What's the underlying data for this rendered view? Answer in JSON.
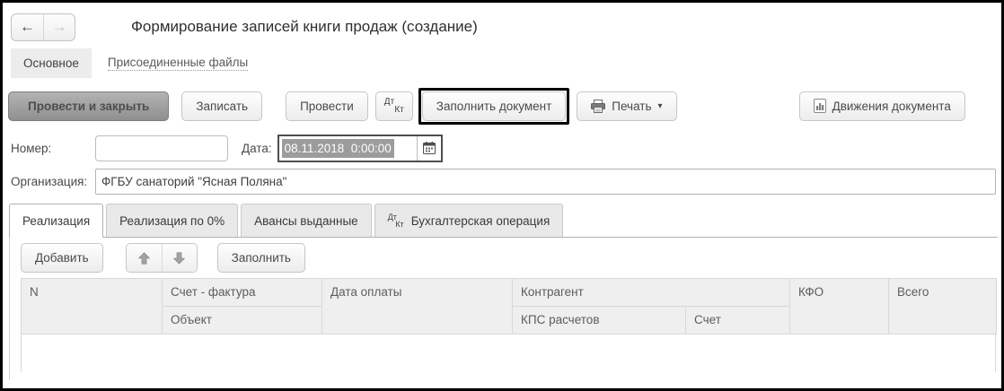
{
  "window": {
    "title": "Формирование записей книги продаж (создание)",
    "nav": {
      "back_glyph": "←",
      "forward_glyph": "→"
    }
  },
  "section_tabs": {
    "main": "Основное",
    "attached_files": "Присоединенные файлы"
  },
  "toolbar": {
    "post_and_close": "Провести и закрыть",
    "write": "Записать",
    "post": "Провести",
    "dtkt": {
      "dt": "Дт",
      "kt": "Кт"
    },
    "fill_document": "Заполнить документ",
    "print": "Печать",
    "print_caret": "▾",
    "movements": "Движения документа"
  },
  "form": {
    "number_label": "Номер:",
    "number_value": "",
    "date_label": "Дата:",
    "date_value": "08.11.2018  0:00:00",
    "org_label": "Организация:",
    "org_value": "ФГБУ санаторий \"Ясная Поляна\""
  },
  "tabs": [
    {
      "label": "Реализация",
      "active": true
    },
    {
      "label": "Реализация по 0%",
      "active": false
    },
    {
      "label": "Авансы выданные",
      "active": false
    },
    {
      "label": "Бухгалтерская операция",
      "active": false,
      "icon": "dtkt-icon"
    }
  ],
  "table_toolbar": {
    "add": "Добавить",
    "fill": "Заполнить"
  },
  "table": {
    "header_row1": [
      "N",
      "Счет - фактура",
      "Дата оплаты",
      "Контрагент",
      "КФО",
      "Всего"
    ],
    "header_row2": [
      "Объект",
      "КПС расчетов",
      "Счет"
    ],
    "rows": []
  },
  "colors": {
    "frame_border": "#000000",
    "primary_button_bg": "#9e9e9e",
    "selection_bg": "#9c9c9c",
    "selection_text": "#ffffff",
    "header_bg": "#efefef",
    "tab_inactive_bg": "#e9e9e9",
    "section_tab_bg": "#ececec",
    "highlight_border": "#000000",
    "border": "#c6c6c6",
    "text": "#4a4a4a"
  }
}
